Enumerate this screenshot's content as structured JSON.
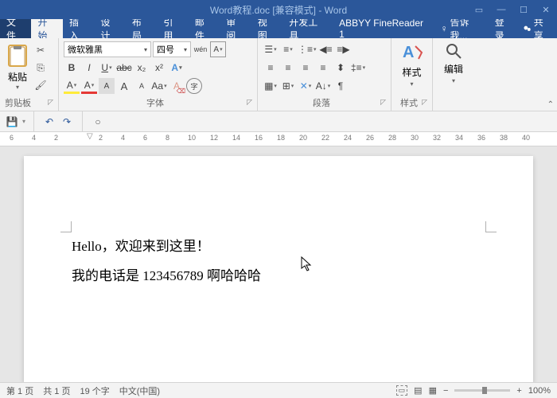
{
  "title": "Word教程.doc [兼容模式] - Word",
  "tabs": {
    "file": "文件",
    "home": "开始",
    "insert": "插入",
    "design": "设计",
    "layout": "布局",
    "references": "引用",
    "mail": "邮件",
    "review": "审阅",
    "view": "视图",
    "dev": "开发工具",
    "abbyy": "ABBYY FineReader 1",
    "tell": "告诉我...",
    "login": "登录",
    "share": "共享"
  },
  "clipboard": {
    "paste": "粘贴",
    "group": "剪贴板"
  },
  "font": {
    "name": "微软雅黑",
    "size": "四号",
    "group": "字体",
    "wen": "wén",
    "bold": "B",
    "italic": "I",
    "underline": "U",
    "strike": "abc",
    "sub": "x₂",
    "sup": "x²",
    "aa_big": "A",
    "aa_small": "A",
    "aa_case": "Aa",
    "clear": "A"
  },
  "para": {
    "group": "段落"
  },
  "styles": {
    "label": "样式"
  },
  "edit": {
    "label": "编辑"
  },
  "document": {
    "line1": "Hello，欢迎来到这里！",
    "line2": "我的电话是 123456789 啊哈哈哈"
  },
  "ruler_marks": [
    "6",
    "4",
    "2",
    "",
    "2",
    "4",
    "6",
    "8",
    "10",
    "12",
    "14",
    "16",
    "18",
    "20",
    "22",
    "24",
    "26",
    "28",
    "30",
    "32",
    "34",
    "36",
    "38",
    "40"
  ],
  "status": {
    "page_sec": "第 1 页",
    "page_total": "共 1 页",
    "words": "19 个字",
    "lang": "中文(中国)",
    "zoom": "100%"
  }
}
